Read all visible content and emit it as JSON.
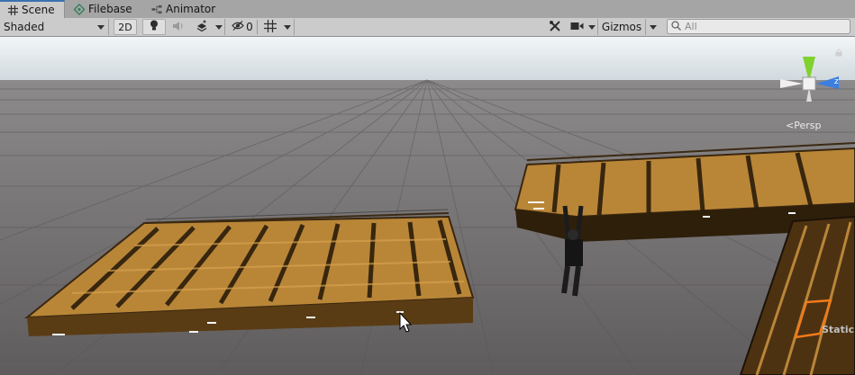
{
  "tabs": [
    {
      "label": "Scene",
      "icon": "grid-icon",
      "active": true
    },
    {
      "label": "Filebase",
      "icon": "filebase-icon",
      "active": false
    },
    {
      "label": "Animator",
      "icon": "animator-icon",
      "active": false
    }
  ],
  "toolbar": {
    "shading_mode": "Shaded",
    "mode_2d": "2D",
    "hidden_count": "0",
    "gizmos_label": "Gizmos",
    "search_placeholder": "All"
  },
  "viewport": {
    "projection_label": "Persp",
    "static_label": "Static"
  },
  "colors": {
    "sky": "#dfe9ee",
    "ground": "#6b6869",
    "wood": "#b98638",
    "x_axis": "#e04a3a",
    "y_axis": "#7fd12e",
    "z_axis": "#3c7fe0",
    "selection": "#f07b1a"
  }
}
